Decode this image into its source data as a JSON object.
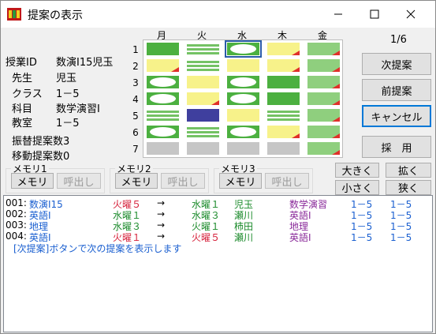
{
  "window": {
    "title": "提案の表示",
    "minimize_glyph": "—",
    "maximize_glyph": "☐",
    "close_glyph": "✕"
  },
  "info": {
    "class_id_label": "授業ID",
    "class_id_value": "数演Ⅰ15児玉",
    "teacher_label": "先生",
    "teacher_value": "児玉",
    "class_label": "クラス",
    "class_value": "1－5",
    "subject_label": "科目",
    "subject_value": "数学演習Ⅰ",
    "room_label": "教室",
    "room_value": "1－5",
    "swap_count_label": "振替提案数3",
    "move_count_label": "移動提案数0"
  },
  "schedule": {
    "days": [
      "月",
      "火",
      "水",
      "木",
      "金"
    ],
    "periods": [
      "1",
      "2",
      "3",
      "4",
      "5",
      "6",
      "7"
    ],
    "grid": [
      [
        "green",
        "stripe",
        "green-oval-sel",
        "yellow-tri",
        "lgreen-tri"
      ],
      [
        "yellow-tri",
        "stripe",
        "yellow",
        "yellow-tri",
        "lgreen-tri"
      ],
      [
        "green-oval",
        "yellow",
        "green-oval",
        "green",
        "lgreen-tri"
      ],
      [
        "green-oval",
        "yellow-tri",
        "green-oval",
        "green",
        "lgreen-tri"
      ],
      [
        "stripe",
        "blue",
        "yellow",
        "stripe",
        "lgreen-tri"
      ],
      [
        "green-oval",
        "stripe",
        "green-oval",
        "yellow-tri",
        "lgreen-tri"
      ],
      [
        "gray",
        "gray",
        "gray",
        "gray",
        "lgreen-tri"
      ]
    ],
    "colors": {
      "green": "#4cb040",
      "yellow": "#f7f28a",
      "gray": "#c6c6c6",
      "blue": "#3f3f9e",
      "light_green": "#8fcf7e",
      "marker_red": "#e0302a"
    }
  },
  "side": {
    "counter": "1/6",
    "next_label": "次提案",
    "prev_label": "前提案",
    "cancel_label": "キャンセル",
    "adopt_label": "採　用"
  },
  "memory": [
    {
      "title": "メモリ1",
      "memory_label": "メモリ",
      "recall_label": "呼出し"
    },
    {
      "title": "メモリ2",
      "memory_label": "メモリ",
      "recall_label": "呼出し"
    },
    {
      "title": "メモリ3",
      "memory_label": "メモリ",
      "recall_label": "呼出し"
    }
  ],
  "zoom": {
    "bigger_label": "大きく",
    "smaller_label": "小さく",
    "expand_label": "拡く",
    "narrow_label": "狭く"
  },
  "log": {
    "rows": [
      {
        "id": "001:",
        "subject_id": "数演Ⅰ15",
        "from": "火曜５",
        "from_color": "red",
        "arrow": "→",
        "to": "水曜１",
        "to_color": "green",
        "teacher": "児玉",
        "subject": "数学演習",
        "class1": "1－5",
        "class2": "1－5"
      },
      {
        "id": "002:",
        "subject_id": "英語Ⅰ",
        "from": "水曜１",
        "from_color": "green",
        "arrow": "→",
        "to": "水曜３",
        "to_color": "green",
        "teacher": "瀬川",
        "subject": "英語Ⅰ",
        "class1": "1－5",
        "class2": "1－5"
      },
      {
        "id": "003:",
        "subject_id": "地理",
        "from": "水曜３",
        "from_color": "green",
        "arrow": "→",
        "to": "火曜１",
        "to_color": "green",
        "teacher": "柿田",
        "subject": "地理",
        "class1": "1－5",
        "class2": "1－5"
      },
      {
        "id": "004:",
        "subject_id": "英語Ⅰ",
        "from": "火曜１",
        "from_color": "red",
        "arrow": "→",
        "to": "火曜５",
        "to_color": "red",
        "teacher": "瀬川",
        "subject": "英語Ⅰ",
        "class1": "1－5",
        "class2": "1－5"
      }
    ],
    "message": "[次提案]ボタンで次の提案を表示します"
  }
}
